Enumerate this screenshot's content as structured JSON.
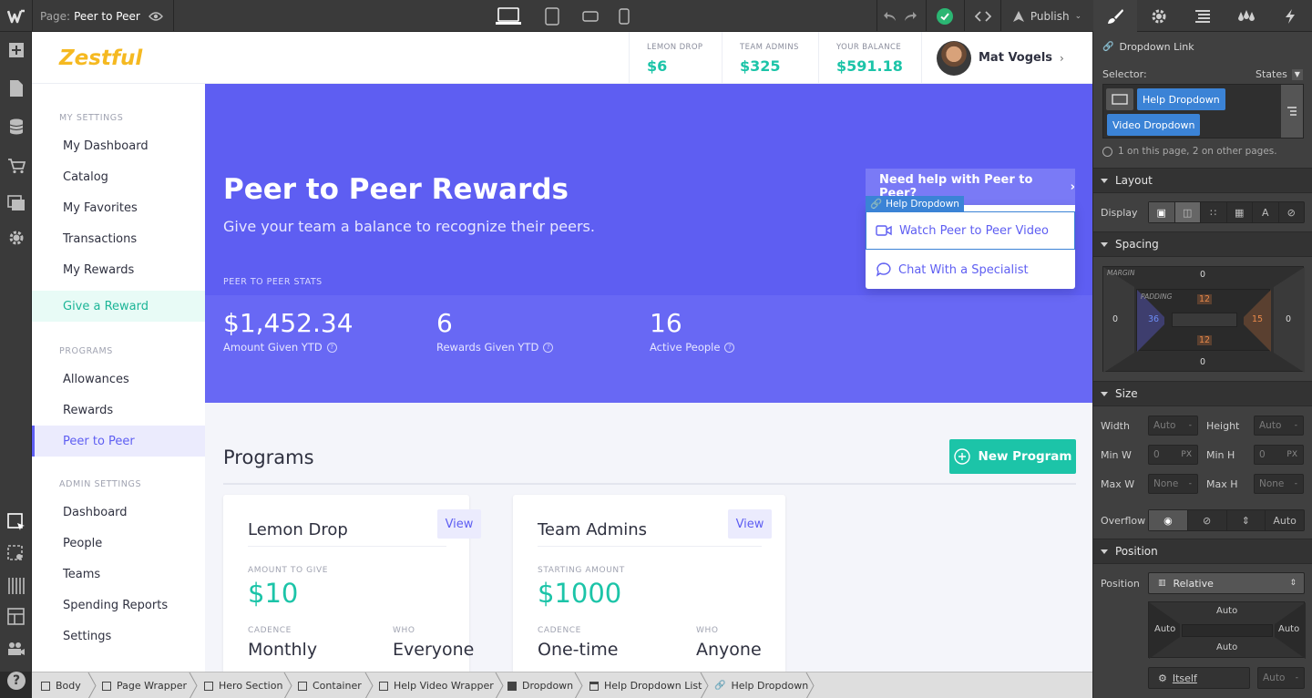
{
  "topbar": {
    "page_label": "Page:",
    "page_name": "Peer to Peer",
    "publish": "Publish"
  },
  "site": {
    "logo": "Zestful",
    "stats": [
      {
        "label": "LEMON DROP",
        "value": "$6"
      },
      {
        "label": "TEAM ADMINS",
        "value": "$325"
      },
      {
        "label": "YOUR BALANCE",
        "value": "$591.18"
      }
    ],
    "user_name": "Mat Vogels"
  },
  "sidebar": {
    "section1": "MY SETTINGS",
    "items1": [
      "My Dashboard",
      "Catalog",
      "My Favorites",
      "Transactions",
      "My Rewards"
    ],
    "give_reward": "Give a Reward",
    "section2": "PROGRAMS",
    "items2": [
      "Allowances",
      "Rewards",
      "Peer to Peer"
    ],
    "section3": "ADMIN SETTINGS",
    "items3": [
      "Dashboard",
      "People",
      "Teams",
      "Spending Reports",
      "Settings"
    ]
  },
  "hero": {
    "title": "Peer to Peer Rewards",
    "subtitle": "Give your team a balance to recognize their peers.",
    "stats_heading": "PEER TO PEER STATS",
    "stats": [
      {
        "value": "$1,452.34",
        "label": "Amount Given YTD"
      },
      {
        "value": "6",
        "label": "Rewards Given YTD"
      },
      {
        "value": "16",
        "label": "Active People"
      }
    ],
    "help_toggle": "Need help with Peer to Peer?",
    "help_tag": "Help Dropdown",
    "help_items": [
      "Watch Peer to Peer Video",
      "Chat With a Specialist"
    ]
  },
  "programs": {
    "title": "Programs",
    "new_button": "New Program",
    "cards": [
      {
        "title": "Lemon Drop",
        "view": "View",
        "amount_label": "AMOUNT TO GIVE",
        "amount": "$10",
        "cadence_label": "CADENCE",
        "cadence": "Monthly",
        "who_label": "WHO",
        "who": "Everyone"
      },
      {
        "title": "Team Admins",
        "view": "View",
        "amount_label": "STARTING AMOUNT",
        "amount": "$1000",
        "cadence_label": "CADENCE",
        "cadence": "One-time",
        "who_label": "WHO",
        "who": "Anyone"
      }
    ]
  },
  "breadcrumbs": [
    "Body",
    "Page Wrapper",
    "Hero Section",
    "Container",
    "Help Video Wrapper",
    "Dropdown",
    "Help Dropdown List",
    "Help Dropdown"
  ],
  "panel": {
    "element": "Dropdown Link",
    "selector_label": "Selector:",
    "states": "States",
    "tags": [
      "Help Dropdown",
      "Video Dropdown"
    ],
    "usage": "1 on this page, 2 on other pages.",
    "layout": "Layout",
    "display": "Display",
    "spacing": "Spacing",
    "margin": "MARGIN",
    "padding": "PADDING",
    "margin_vals": {
      "top": "0",
      "right": "0",
      "bottom": "0",
      "left": "0"
    },
    "padding_vals": {
      "top": "12",
      "right": "15",
      "bottom": "12",
      "left": "36"
    },
    "size": "Size",
    "size_fields": {
      "width": "Width",
      "height": "Height",
      "minw": "Min W",
      "minh": "Min H",
      "maxw": "Max W",
      "maxh": "Max H",
      "auto": "Auto",
      "zero": "0",
      "none": "None",
      "px": "PX",
      "dash": "-"
    },
    "overflow": "Overflow",
    "overflow_auto": "Auto",
    "position_h": "Position",
    "position_label": "Position",
    "position_val": "Relative",
    "pos_auto": "Auto",
    "itself": "Itself"
  },
  "colors": {
    "brand": "#5e5ef2",
    "accent": "#1cc4a8",
    "logo": "#f5b921",
    "webflow_blue": "#3b83d6"
  }
}
